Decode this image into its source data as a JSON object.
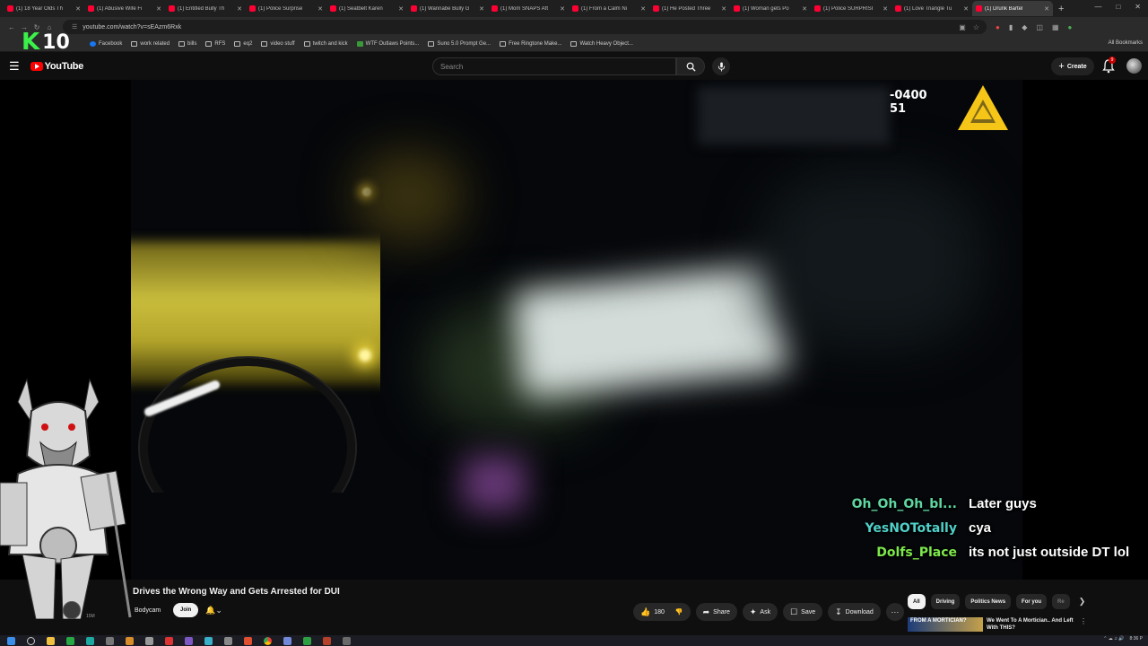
{
  "tabs": [
    {
      "title": "(1) 18 Year Olds Th"
    },
    {
      "title": "(1) Abusive Wife Fi"
    },
    {
      "title": "(1) Entitled Bully Th"
    },
    {
      "title": "(1) Police Surprise"
    },
    {
      "title": "(1) Seatbelt Karen"
    },
    {
      "title": "(1) Wannabe Bully G"
    },
    {
      "title": "(1) Mom SNAPS Aft"
    },
    {
      "title": "(1) From a Calm Ni"
    },
    {
      "title": "(1) He Posted Three"
    },
    {
      "title": "(1) Woman gets Po"
    },
    {
      "title": "(1) Police SURPRISI"
    },
    {
      "title": "(1) Love Triangle Tu"
    },
    {
      "title": "(1) Drunk Bartel",
      "active": true
    }
  ],
  "address": {
    "url": "youtube.com/watch?v=sEAzm6Rxk"
  },
  "bookmarks": [
    {
      "label": "Facebook",
      "icon": "facebook-icon"
    },
    {
      "label": "work related",
      "icon": "folder-icon"
    },
    {
      "label": "bills",
      "icon": "folder-icon"
    },
    {
      "label": "RFS",
      "icon": "folder-icon"
    },
    {
      "label": "eq2",
      "icon": "folder-icon"
    },
    {
      "label": "video stuff",
      "icon": "folder-icon"
    },
    {
      "label": "twitch and kick",
      "icon": "folder-icon"
    },
    {
      "label": "WTF Outlaws Points...",
      "icon": "wtf-icon"
    },
    {
      "label": "Suno 5.0 Prompt Ge...",
      "icon": "suno-icon"
    },
    {
      "label": "Free Ringtone Make...",
      "icon": "ringtone-icon"
    },
    {
      "label": "Watch Heavy Object...",
      "icon": "watch-icon"
    }
  ],
  "bookmarks_all": "All Bookmarks",
  "overlay": {
    "k_letter": "K",
    "k_number": "10"
  },
  "youtube": {
    "logo_text": "YouTube",
    "search_placeholder": "Search",
    "create_label": "Create",
    "notification_count": "9"
  },
  "video": {
    "timestamp_line1": "-0400",
    "timestamp_line2": "51"
  },
  "chat": [
    {
      "user": "Oh_Oh_Oh_bl...",
      "message": "Later guys",
      "color": "#5fd6a0"
    },
    {
      "user": "YesNOTotally",
      "message": "cya",
      "color": "#4fd0c8"
    },
    {
      "user": "Dolfs_Place",
      "message": "its not just outside DT lol",
      "color": "#7ce84a"
    }
  ],
  "video_title": "Drives the Wrong Way and Gets Arrested for DUI",
  "channel": {
    "name": "Bodycam",
    "name_prefix": "T",
    "subs": "15M",
    "join_label": "Join"
  },
  "actions": {
    "likes": "180",
    "share": "Share",
    "ask": "Ask",
    "save": "Save",
    "download": "Download"
  },
  "chips": [
    "All",
    "Driving",
    "Politics News",
    "For you",
    "Re"
  ],
  "recommended": {
    "thumb_text": "FROM A MORTICIAN?",
    "title": "We Went To A Mortician.. And Left With THIS?"
  },
  "taskbar": {
    "time": "8:36 P"
  },
  "colors": {
    "accent": "#ff0000",
    "k10_green": "#3bf04a",
    "axon_yellow": "#f5c518"
  }
}
